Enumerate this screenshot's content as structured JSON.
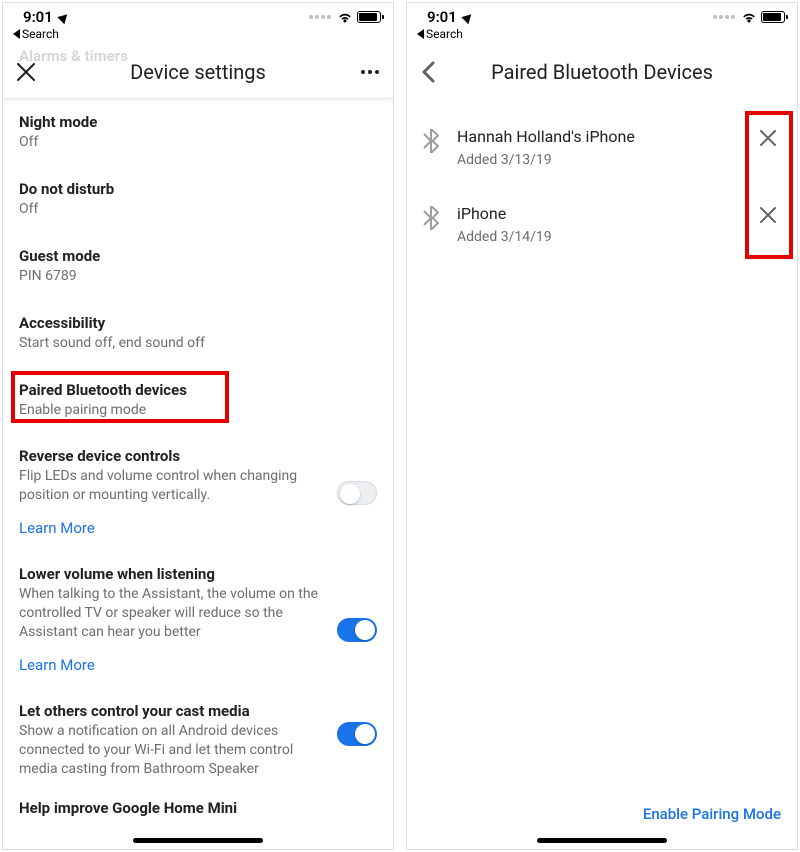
{
  "status": {
    "time": "9:01",
    "back_label": "Search"
  },
  "left": {
    "header_title": "Device settings",
    "peek_title": "Alarms & timers",
    "items": {
      "night_mode": {
        "title": "Night mode",
        "sub": "Off"
      },
      "dnd": {
        "title": "Do not disturb",
        "sub": "Off"
      },
      "guest": {
        "title": "Guest mode",
        "sub": "PIN 6789"
      },
      "access": {
        "title": "Accessibility",
        "sub": "Start sound off, end sound off"
      },
      "paired": {
        "title": "Paired Bluetooth devices",
        "sub": "Enable pairing mode"
      },
      "reverse": {
        "title": "Reverse device controls",
        "sub": "Flip LEDs and volume control when changing position or mounting vertically.",
        "learn": "Learn More",
        "on": false
      },
      "lower": {
        "title": "Lower volume when listening",
        "sub": "When talking to the Assistant, the volume on the controlled TV or speaker will reduce so the Assistant can hear you better",
        "learn": "Learn More",
        "on": true
      },
      "cast": {
        "title": "Let others control your cast media",
        "sub": "Show a notification on all Android devices connected to your Wi-Fi and let them control media casting from Bathroom Speaker",
        "on": true
      },
      "improve": {
        "title": "Help improve Google Home Mini"
      }
    }
  },
  "right": {
    "header_title": "Paired Bluetooth Devices",
    "devices": [
      {
        "name": "Hannah Holland's iPhone",
        "added": "Added 3/13/19"
      },
      {
        "name": "iPhone",
        "added": "Added 3/14/19"
      }
    ],
    "enable_label": "Enable Pairing Mode"
  }
}
